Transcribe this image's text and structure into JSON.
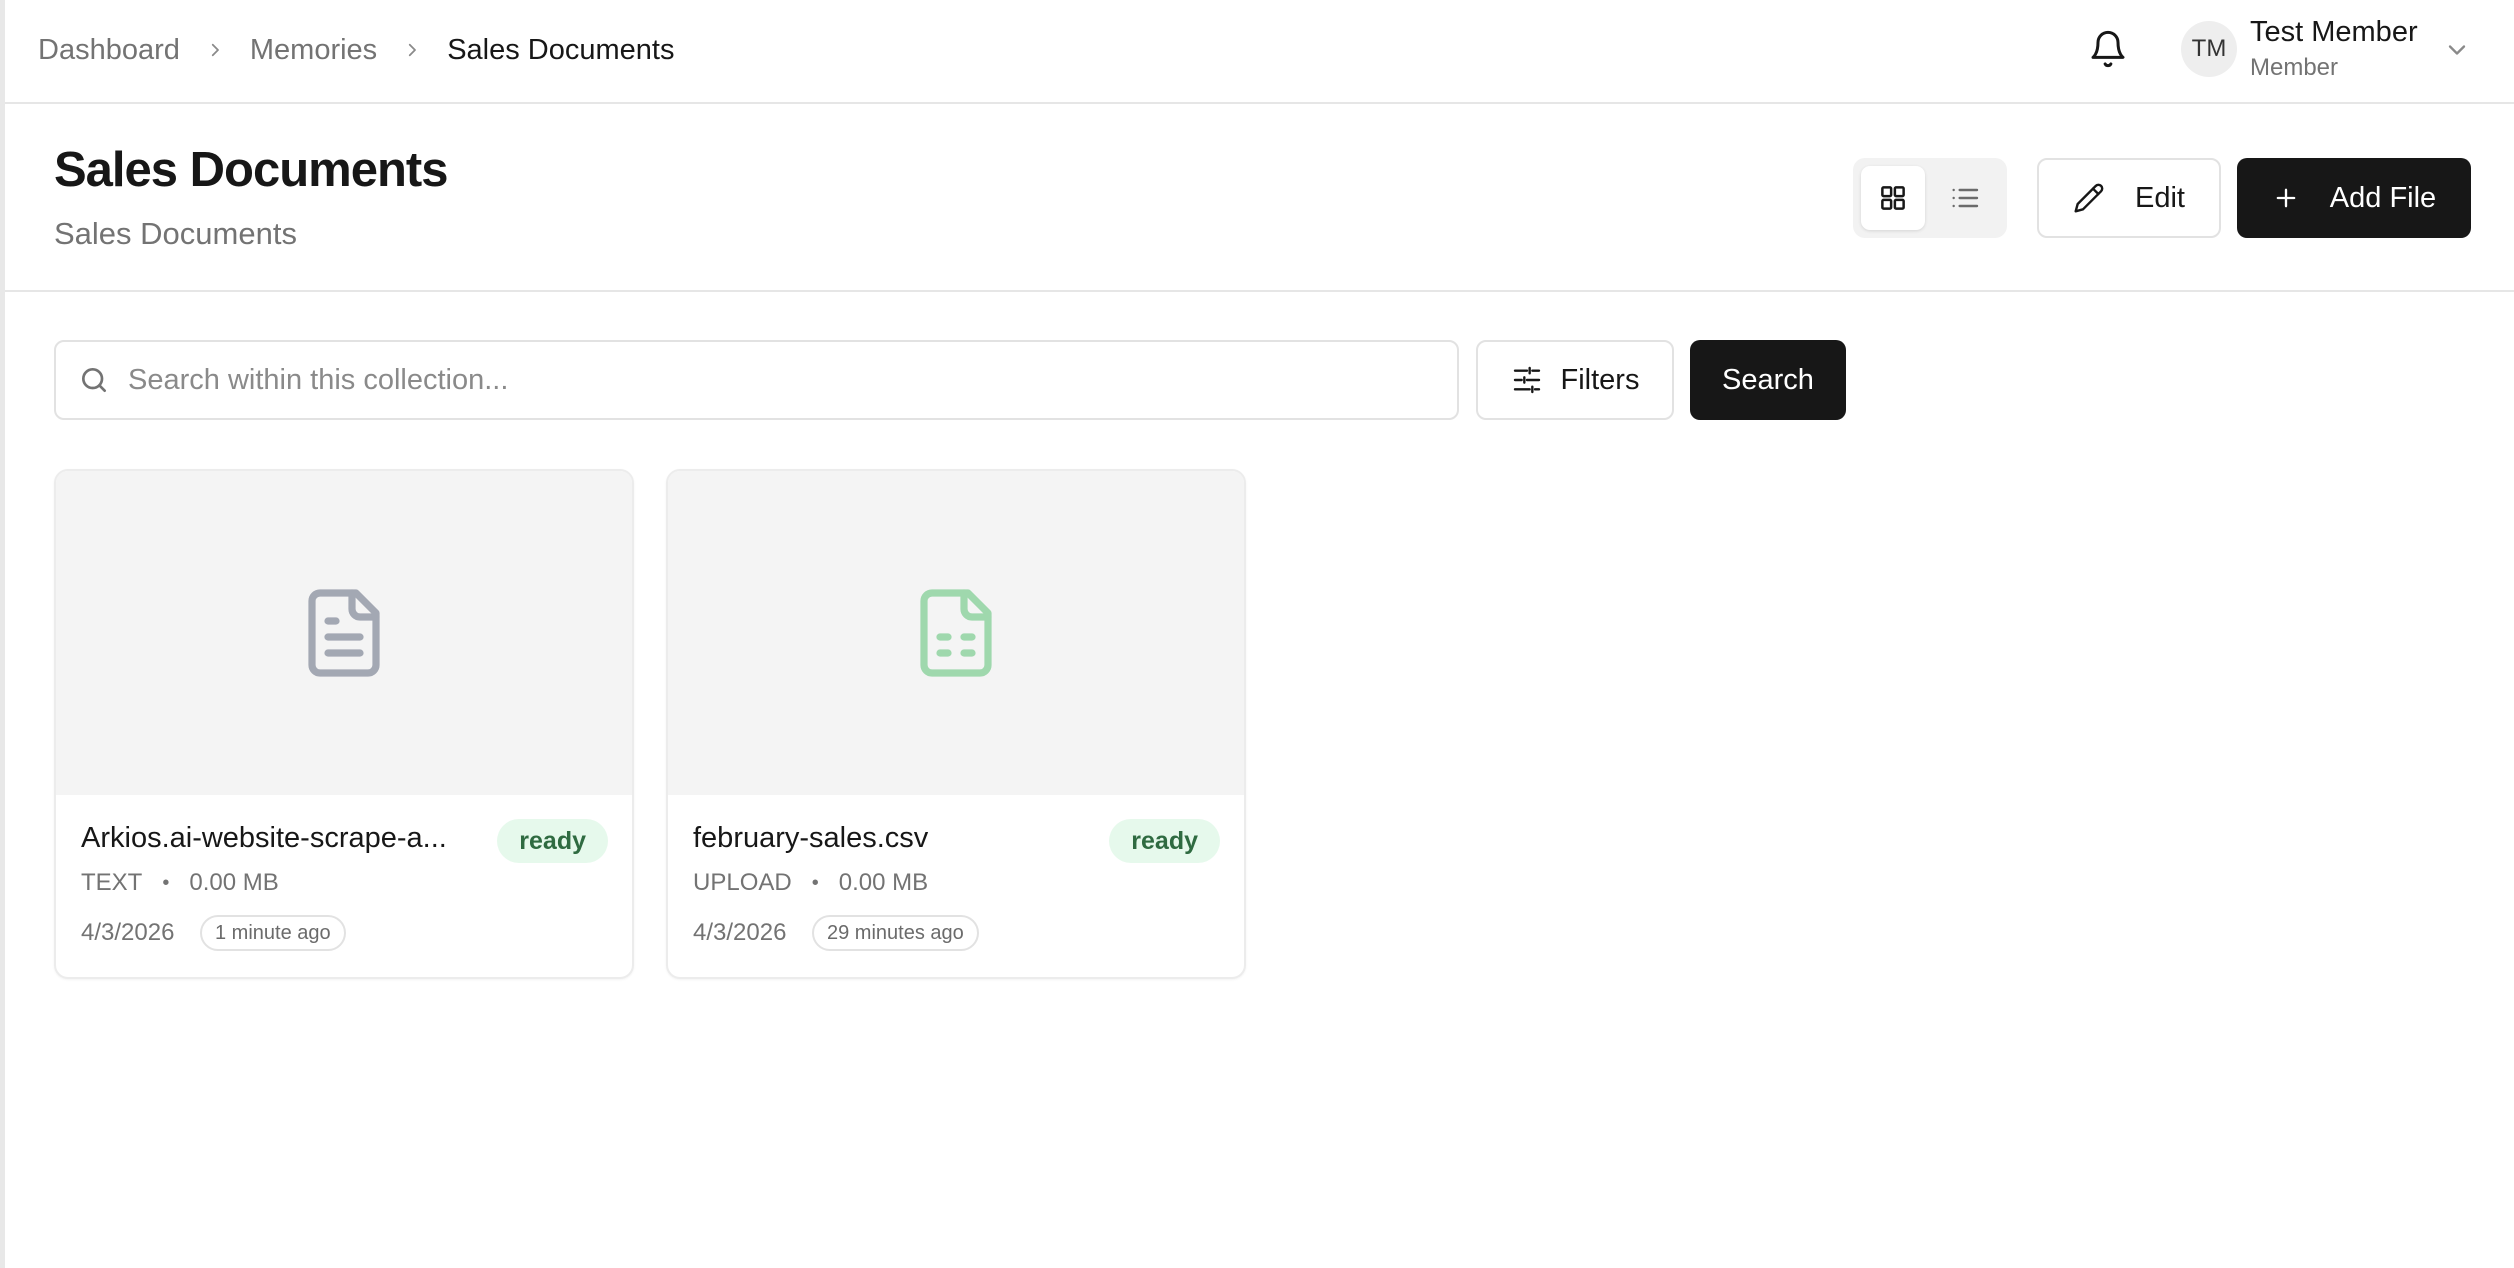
{
  "breadcrumb": {
    "items": [
      "Dashboard",
      "Memories"
    ],
    "current": "Sales Documents"
  },
  "user": {
    "initials": "TM",
    "name": "Test Member",
    "role": "Member"
  },
  "page": {
    "title": "Sales Documents",
    "subtitle": "Sales Documents"
  },
  "toolbar": {
    "edit_label": "Edit",
    "add_label": "Add File",
    "view_mode": "grid"
  },
  "search": {
    "placeholder": "Search within this collection...",
    "value": "",
    "filters_label": "Filters",
    "search_label": "Search"
  },
  "files": [
    {
      "name": "Arkios.ai-website-scrape-a...",
      "status": "ready",
      "type": "TEXT",
      "size": "0.00 MB",
      "date": "4/3/2026",
      "relative_time": "1 minute ago",
      "icon": "file-text-icon",
      "icon_color": "#a3a8b3"
    },
    {
      "name": "february-sales.csv",
      "status": "ready",
      "type": "UPLOAD",
      "size": "0.00 MB",
      "date": "4/3/2026",
      "relative_time": "29 minutes ago",
      "icon": "file-spreadsheet-icon",
      "icon_color": "#9fd8ad"
    }
  ],
  "colors": {
    "primary": "#171717",
    "muted_text": "#737373",
    "border": "#e2e2e2",
    "status_ready_bg": "#e6f9ec",
    "status_ready_text": "#2f6b41"
  }
}
